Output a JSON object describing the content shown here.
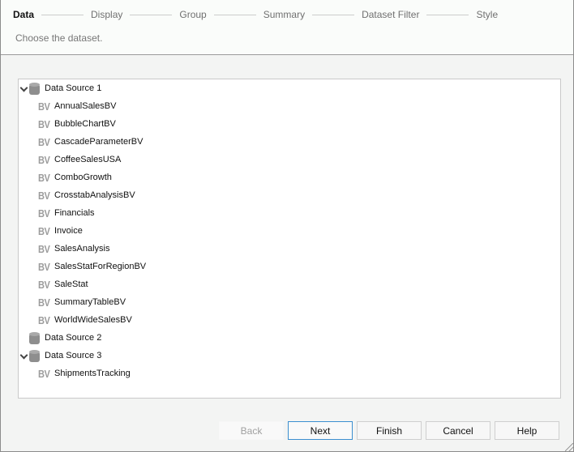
{
  "wizard": {
    "steps": [
      {
        "label": "Data",
        "active": true
      },
      {
        "label": "Display",
        "active": false
      },
      {
        "label": "Group",
        "active": false
      },
      {
        "label": "Summary",
        "active": false
      },
      {
        "label": "Dataset Filter",
        "active": false
      },
      {
        "label": "Style",
        "active": false
      }
    ],
    "subtitle": "Choose the dataset."
  },
  "tree": {
    "sources": [
      {
        "label": "Data Source 1",
        "expanded": true,
        "icon": "database-icon",
        "items": [
          "AnnualSalesBV",
          "BubbleChartBV",
          "CascadeParameterBV",
          "CoffeeSalesUSA",
          "ComboGrowth",
          "CrosstabAnalysisBV",
          "Financials",
          "Invoice",
          "SalesAnalysis",
          "SalesStatForRegionBV",
          "SaleStat",
          "SummaryTableBV",
          "WorldWideSalesBV"
        ]
      },
      {
        "label": "Data Source 2",
        "expanded": false,
        "icon": "database-icon",
        "items": []
      },
      {
        "label": "Data Source 3",
        "expanded": true,
        "icon": "database-icon",
        "items": [
          "ShipmentsTracking"
        ]
      }
    ],
    "item_icon_text": "BV"
  },
  "buttons": {
    "back": {
      "label": "Back",
      "enabled": false
    },
    "next": {
      "label": "Next",
      "enabled": true
    },
    "finish": {
      "label": "Finish",
      "enabled": true
    },
    "cancel": {
      "label": "Cancel",
      "enabled": true
    },
    "help": {
      "label": "Help",
      "enabled": true
    }
  }
}
